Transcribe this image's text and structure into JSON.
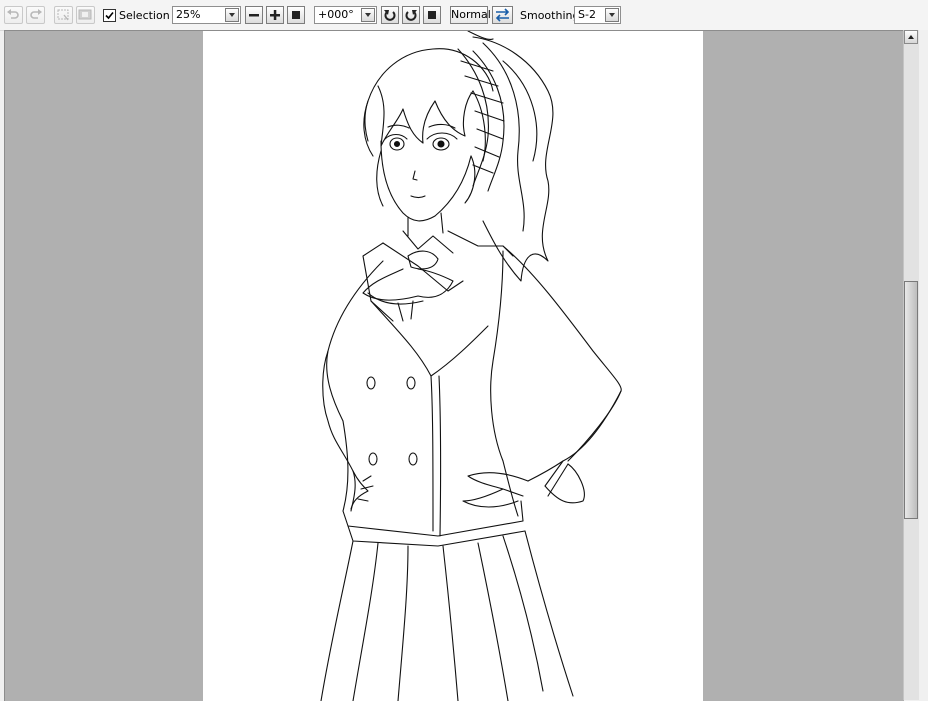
{
  "toolbar": {
    "selection_label": "Selection",
    "selection_checked": true,
    "zoom_value": "25%",
    "rotation_value": "+000°",
    "blend_mode_label": "Normal",
    "smoothing_label": "Smoothing",
    "smoothing_value": "S-2"
  },
  "canvas": {
    "background_color": "#b0b0b0",
    "paper_color": "#ffffff"
  }
}
